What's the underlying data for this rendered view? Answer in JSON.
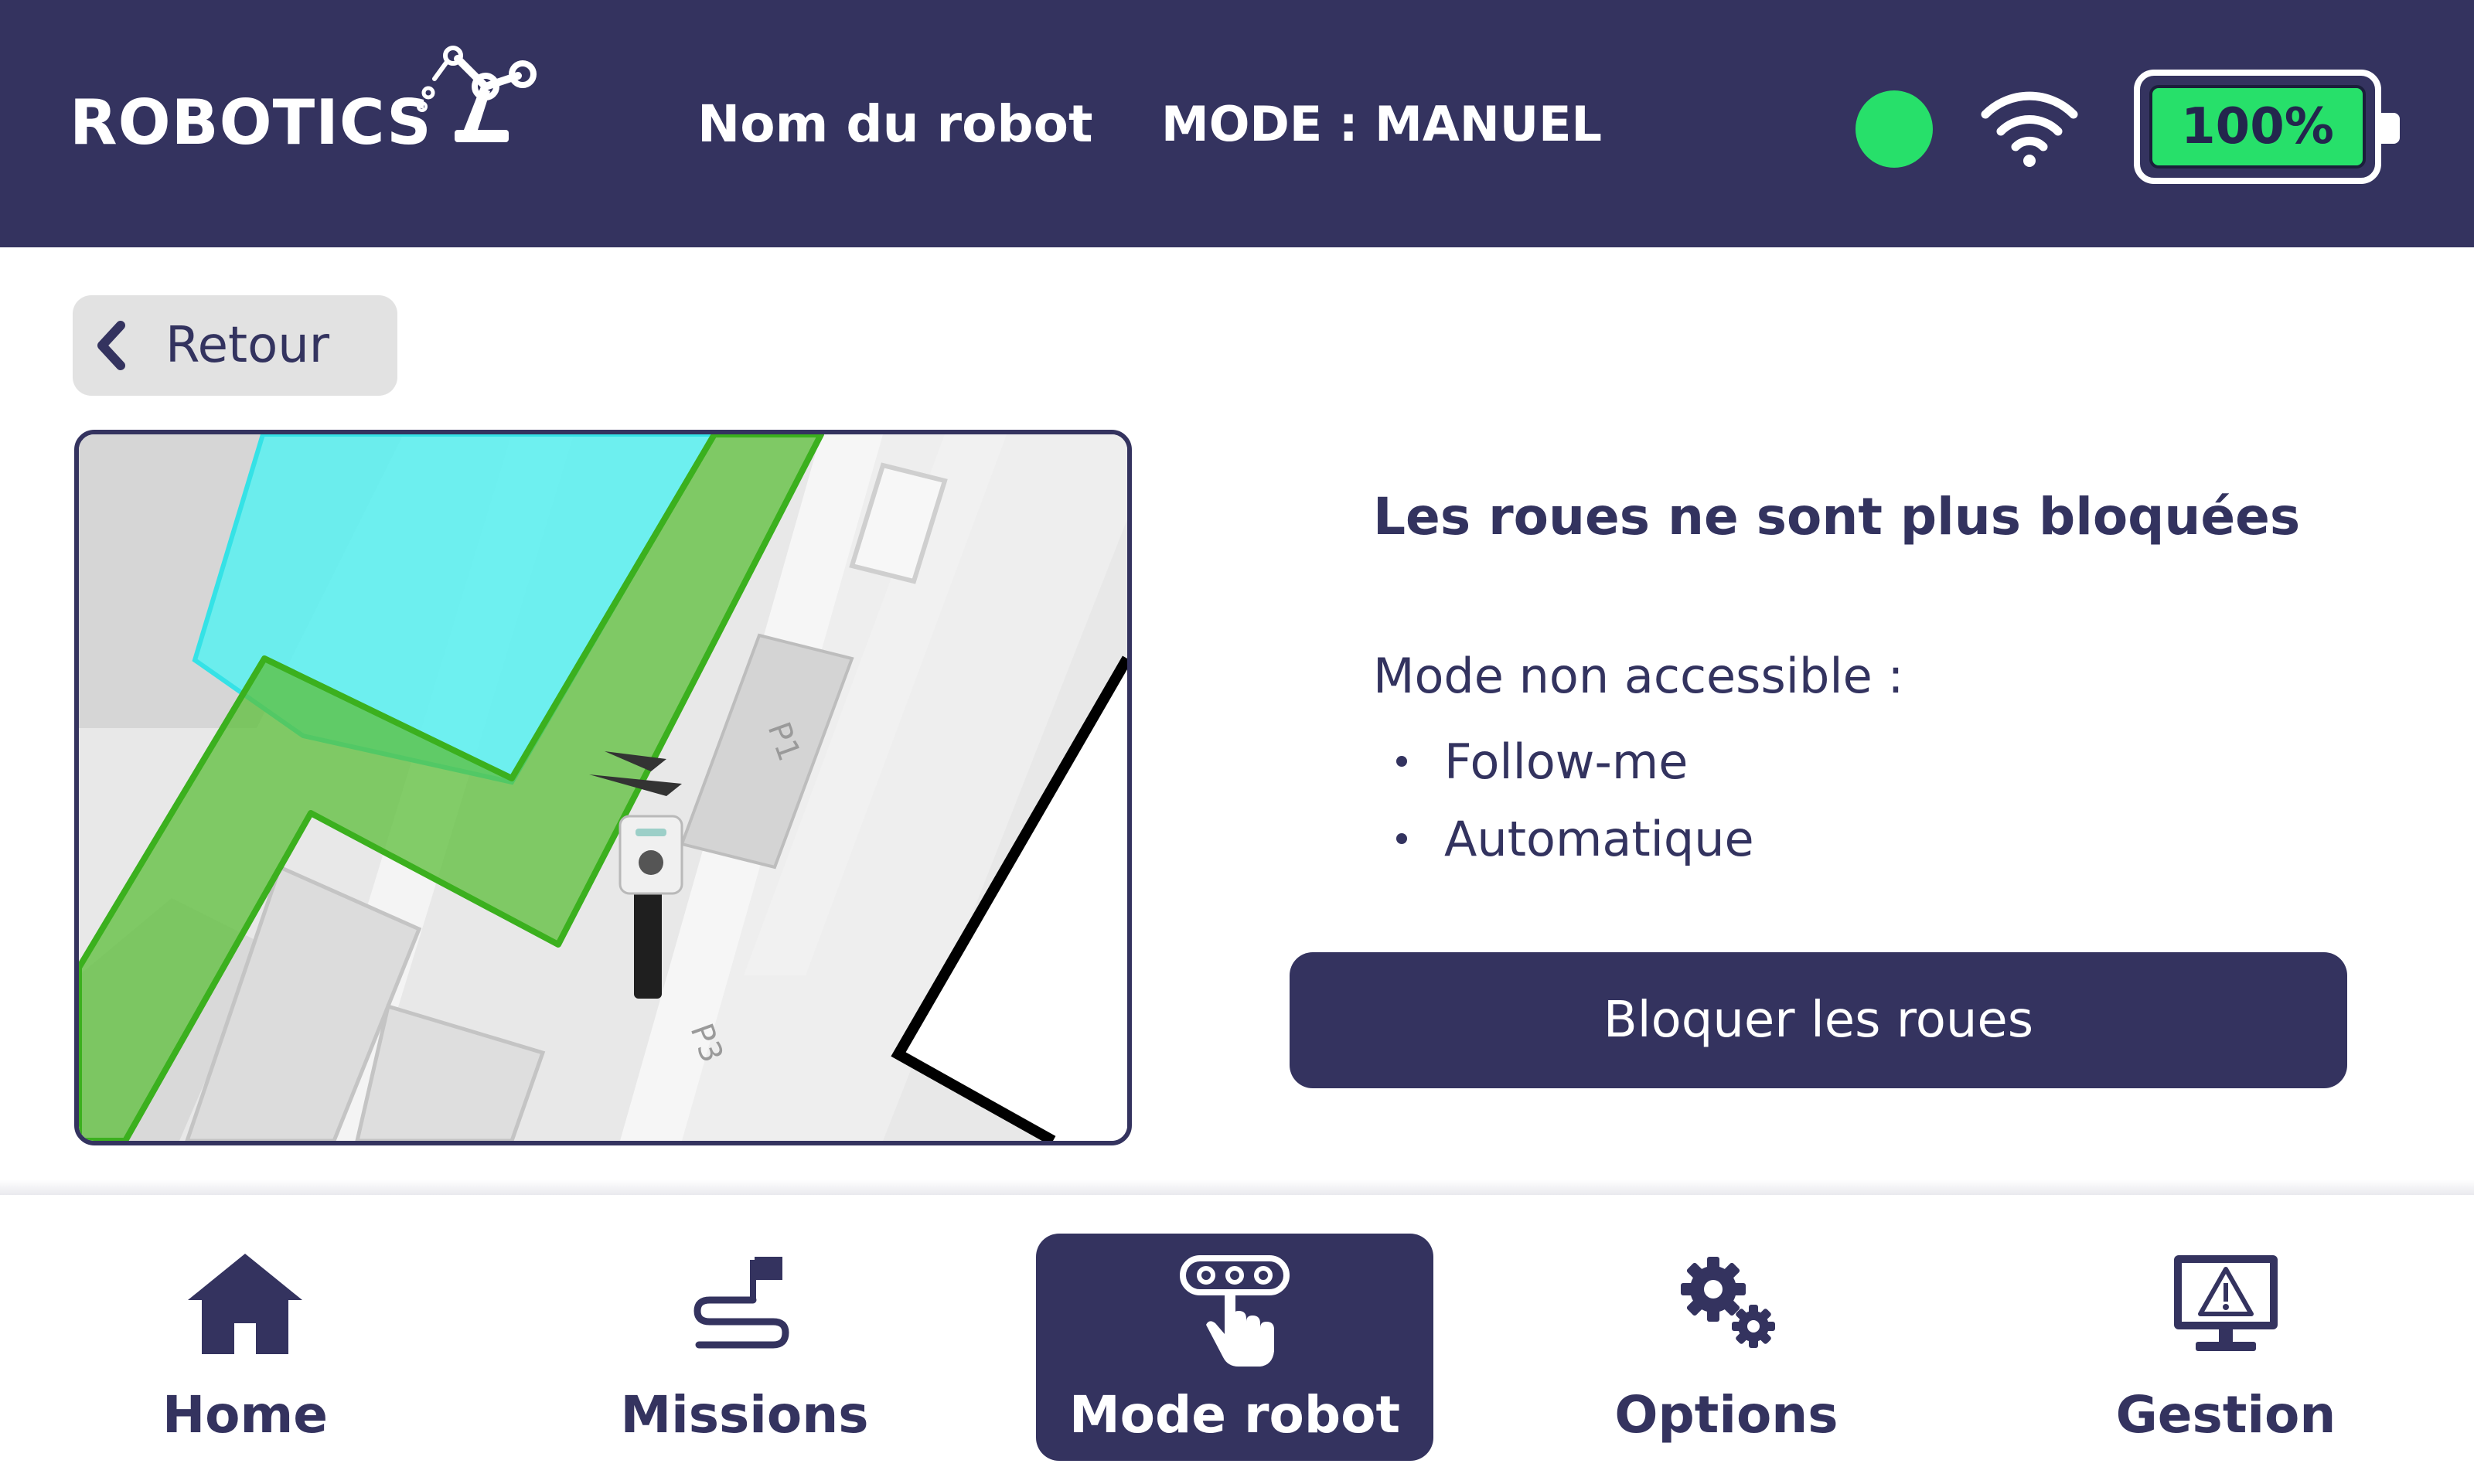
{
  "header": {
    "brand": "ROBOTICS",
    "robot_name": "Nom du robot",
    "mode": "MODE : MANUEL",
    "connection_icon": "status-dot",
    "wifi_icon": "wifi-icon",
    "battery": "100%"
  },
  "back": {
    "label": "Retour"
  },
  "map": {
    "labels": [
      "P1",
      "P3"
    ]
  },
  "info": {
    "title": "Les roues ne sont plus bloquées",
    "subtitle": "Mode non accessible :",
    "items": [
      "Follow-me",
      "Automatique"
    ],
    "action": "Bloquer les roues"
  },
  "nav": {
    "items": [
      {
        "label": "Home",
        "icon": "home-icon"
      },
      {
        "label": "Missions",
        "icon": "mission-path-flag-icon"
      },
      {
        "label": "Mode robot",
        "icon": "robot-mode-hand-icon"
      },
      {
        "label": "Options",
        "icon": "gears-icon"
      },
      {
        "label": "Gestion",
        "icon": "monitor-warning-icon"
      }
    ],
    "active": "Mode robot"
  },
  "colors": {
    "primary": "#34335f",
    "status_green": "#27e06a",
    "back_button_bg": "#e2e2e2",
    "map_zone_green": "#5cbf3a",
    "map_zone_cyan": "#5ff0f0"
  }
}
